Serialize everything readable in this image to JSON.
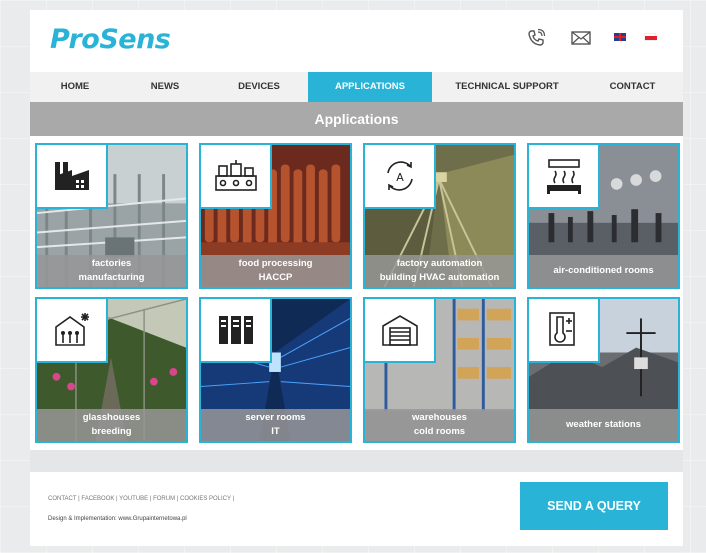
{
  "header": {
    "logo": "ProSens",
    "icons": [
      "phone-icon",
      "mail-icon",
      "flag-uk-icon",
      "flag-pl-icon"
    ]
  },
  "nav": {
    "items": [
      {
        "label": "HOME"
      },
      {
        "label": "NEWS"
      },
      {
        "label": "DEVICES"
      },
      {
        "label": "APPLICATIONS",
        "active": true
      },
      {
        "label": "TECHNICAL SUPPORT"
      },
      {
        "label": "CONTACT"
      }
    ]
  },
  "section": {
    "title": "Applications"
  },
  "cards": [
    {
      "icon": "factory-icon",
      "line1": "factories",
      "line2": "manufacturing"
    },
    {
      "icon": "food-processing-icon",
      "line1": "food processing",
      "line2": "HACCP"
    },
    {
      "icon": "automation-icon",
      "line1": "factory automation",
      "line2": "building HVAC automation"
    },
    {
      "icon": "air-conditioner-icon",
      "line1": "air-conditioned rooms",
      "line2": ""
    },
    {
      "icon": "greenhouse-icon",
      "line1": "glasshouses",
      "line2": "breeding"
    },
    {
      "icon": "server-icon",
      "line1": "server rooms",
      "line2": "IT"
    },
    {
      "icon": "warehouse-icon",
      "line1": "warehouses",
      "line2": "cold rooms"
    },
    {
      "icon": "thermometer-icon",
      "line1": "weather stations",
      "line2": ""
    }
  ],
  "footer": {
    "links": [
      "CONTACT",
      "FACEBOOK",
      "YOUTUBE",
      "FORUM",
      "COOKIES POLICY"
    ],
    "credit": "Design & Implementation: www.Grupainternetowa.pl",
    "cta": "SEND A QUERY"
  },
  "colors": {
    "accent": "#29b3d6",
    "section_bar": "#a9a9a9"
  }
}
